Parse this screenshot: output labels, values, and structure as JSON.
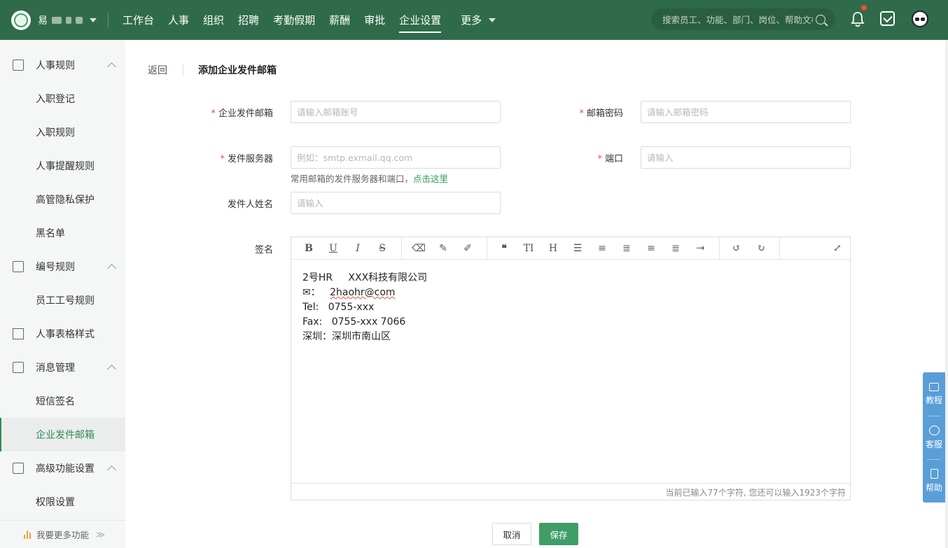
{
  "topbar": {
    "company_initial": "易",
    "nav": [
      "工作台",
      "人事",
      "组织",
      "招聘",
      "考勤假期",
      "薪酬",
      "审批",
      "企业设置"
    ],
    "nav_more": "更多",
    "active_nav": "企业设置",
    "search_placeholder": "搜索员工、功能、部门、岗位、帮助文档"
  },
  "sidebar": {
    "groups": [
      {
        "label": "人事规则",
        "items": [
          "入职登记",
          "入职规则",
          "人事提醒规则",
          "高管隐私保护",
          "黑名单"
        ]
      },
      {
        "label": "编号规则",
        "items": [
          "员工工号规则"
        ]
      },
      {
        "label": "人事表格样式"
      },
      {
        "label": "消息管理",
        "items": [
          "短信签名",
          "企业发件邮箱"
        ]
      },
      {
        "label": "高级功能设置",
        "items": [
          "权限设置"
        ]
      }
    ],
    "footer": "我要更多功能"
  },
  "page": {
    "back": "返回",
    "title": "添加企业发件邮箱",
    "fields": {
      "email_label": "企业发件邮箱",
      "email_placeholder": "请输入邮箱账号",
      "password_label": "邮箱密码",
      "password_placeholder": "请输入邮箱密码",
      "server_label": "发件服务器",
      "server_placeholder": "例如：smtp.exmail.qq.com",
      "port_label": "端口",
      "port_placeholder": "请输入",
      "hint_text": "常用邮箱的发件服务器和端口，",
      "hint_link": "点击这里",
      "sender_label": "发件人姓名",
      "sender_placeholder": "请输入",
      "signature_label": "签名"
    },
    "editor": {
      "lines": [
        "2号HR     XXX科技有限公司",
        "✉：",
        "Tel:   0755-xxx",
        "Fax:   0755-xxx 7066",
        "深圳：深圳市南山区"
      ],
      "email_value": "2haohr@com",
      "counter": "当前已输入77个字符, 您还可以输入1923个字符"
    },
    "buttons": {
      "cancel": "取消",
      "save": "保存"
    }
  },
  "float_panel": [
    "教程",
    "客服",
    "帮助"
  ]
}
